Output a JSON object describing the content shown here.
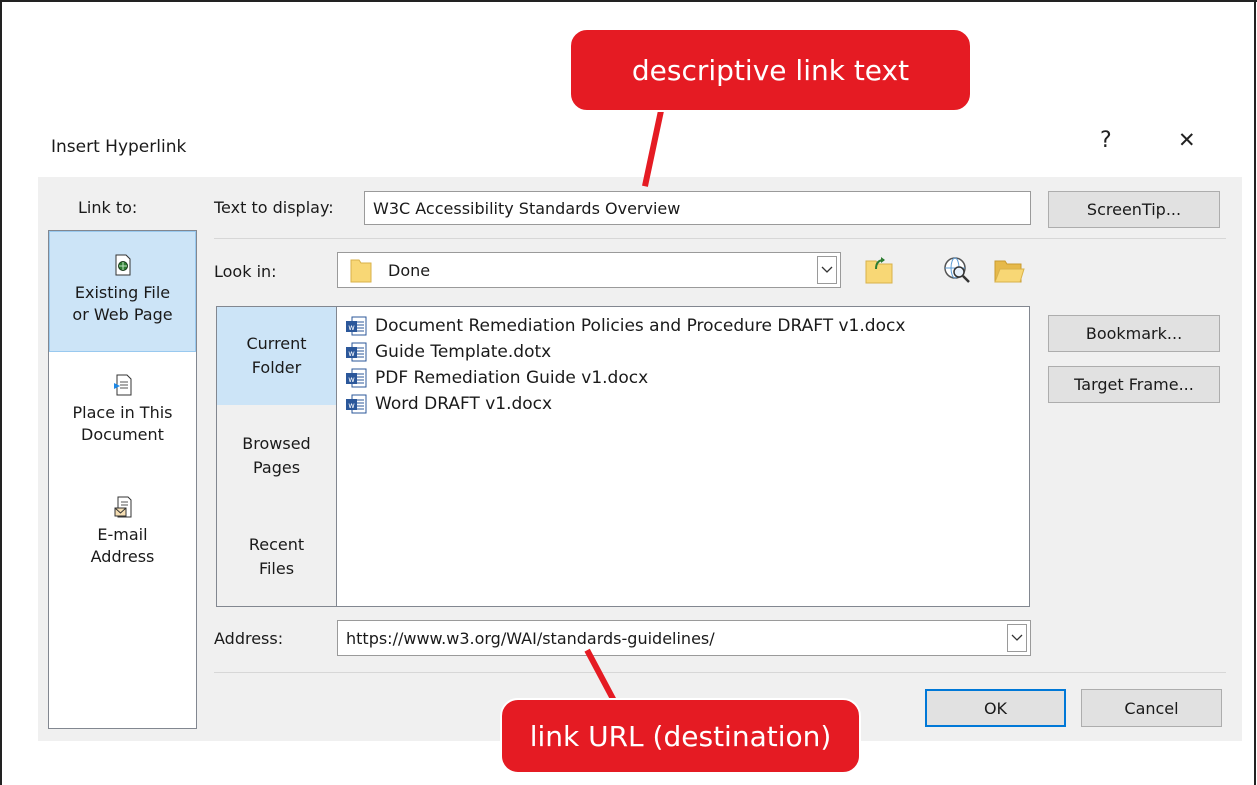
{
  "window": {
    "title": "Insert Hyperlink",
    "help_label": "?",
    "close_label": "✕"
  },
  "link_to": {
    "label": "Link to:",
    "items": [
      {
        "line1": "Existing File",
        "line2": "or Web Page",
        "icon": "existing-file-icon",
        "selected": true
      },
      {
        "line1": "Place in This",
        "line2": "Document",
        "icon": "place-in-document-icon",
        "selected": false
      },
      {
        "line1": "E-mail",
        "line2": "Address",
        "icon": "email-address-icon",
        "selected": false
      }
    ]
  },
  "text_to_display": {
    "label": "Text to display:",
    "value": "W3C Accessibility Standards Overview"
  },
  "look_in": {
    "label": "Look in:",
    "value": "Done"
  },
  "nav": {
    "items": [
      {
        "line1": "Current",
        "line2": "Folder",
        "selected": true
      },
      {
        "line1": "Browsed",
        "line2": "Pages",
        "selected": false
      },
      {
        "line1": "Recent",
        "line2": "Files",
        "selected": false
      }
    ]
  },
  "files": [
    "Document Remediation Policies and Procedure DRAFT v1.docx",
    "Guide Template.dotx",
    "PDF Remediation Guide v1.docx",
    "Word DRAFT v1.docx"
  ],
  "address": {
    "label": "Address:",
    "value": "https://www.w3.org/WAI/standards-guidelines/"
  },
  "buttons": {
    "screentip": "ScreenTip...",
    "bookmark": "Bookmark...",
    "target_frame": "Target Frame...",
    "ok": "OK",
    "cancel": "Cancel"
  },
  "callouts": {
    "top": "descriptive link text",
    "bottom": "link URL (destination)"
  },
  "colors": {
    "callout_red": "#e51b23",
    "selection_blue": "#cce4f7",
    "default_button_border": "#0078d7",
    "word_icon_blue": "#2b579a"
  }
}
